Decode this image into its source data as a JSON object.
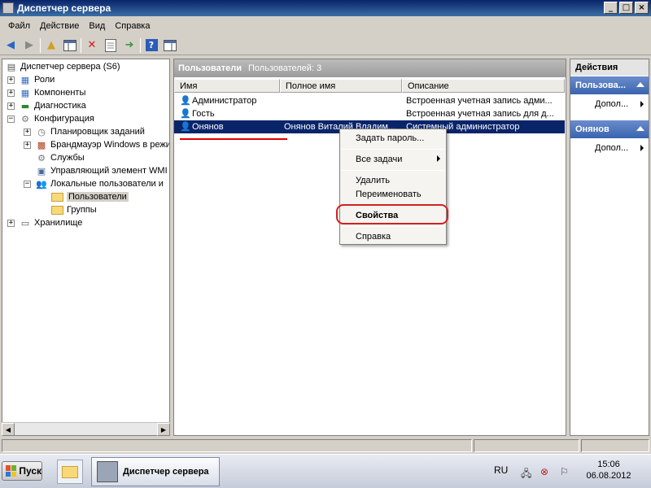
{
  "window": {
    "title": "Диспетчер сервера",
    "controls": [
      "_",
      "□",
      "×"
    ]
  },
  "menu": [
    "Файл",
    "Действие",
    "Вид",
    "Справка"
  ],
  "tree": {
    "items": [
      {
        "label": "Диспетчер сервера (S6)"
      },
      {
        "label": "Роли"
      },
      {
        "label": "Компоненты"
      },
      {
        "label": "Диагностика"
      },
      {
        "label": "Конфигурация"
      },
      {
        "label": "Планировщик заданий"
      },
      {
        "label": "Брандмауэр Windows в режи"
      },
      {
        "label": "Службы"
      },
      {
        "label": "Управляющий элемент WMI"
      },
      {
        "label": "Локальные пользователи и"
      },
      {
        "label": "Пользователи"
      },
      {
        "label": "Группы"
      },
      {
        "label": "Хранилище"
      }
    ]
  },
  "list": {
    "header": "Пользователи",
    "count": "Пользователей: 3",
    "columns": [
      "Имя",
      "Полное имя",
      "Описание"
    ],
    "rows": [
      {
        "name": "Администратор",
        "fullname": "",
        "desc": "Встроенная учетная запись адми..."
      },
      {
        "name": "Гость",
        "fullname": "",
        "desc": "Встроенная учетная запись для д..."
      },
      {
        "name": "Онянов",
        "fullname": "Онянов Виталий Владим...",
        "desc": "Системный администратор"
      }
    ]
  },
  "context_menu": {
    "set_password": "Задать пароль...",
    "all_tasks": "Все задачи",
    "delete": "Удалить",
    "rename": "Переименовать",
    "properties": "Свойства",
    "help": "Справка"
  },
  "actions": {
    "title": "Действия",
    "group1": "Пользова...",
    "item1": "Допол...",
    "group2": "Онянов",
    "item2": "Допол..."
  },
  "taskbar": {
    "start": "Пуск",
    "app": "Диспетчер сервера",
    "lang": "RU",
    "time": "15:06",
    "date": "06.08.2012"
  },
  "colors": {
    "selection": "#0a246a",
    "highlight_ring": "#d42020",
    "underline": "#e00000"
  }
}
